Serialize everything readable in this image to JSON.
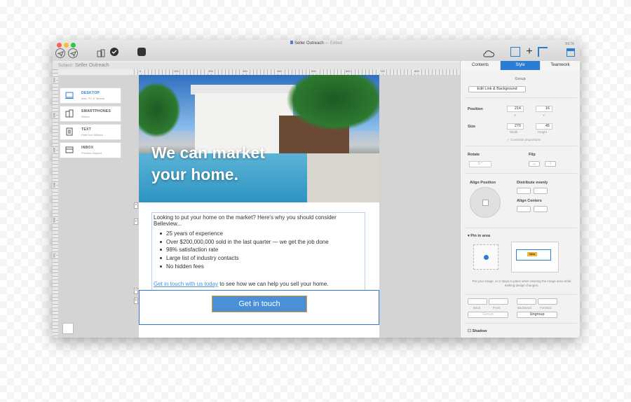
{
  "window": {
    "title": "Seller Outreach",
    "edited": "— Edited",
    "beta": "BETA"
  },
  "subject": {
    "label": "Subject",
    "value": "Seller Outreach"
  },
  "ruler_ticks": [
    "0",
    "100",
    "200",
    "300",
    "400",
    "500",
    "600",
    "700",
    "800"
  ],
  "vruler_ticks": [
    "200",
    "300",
    "400",
    "500",
    "600",
    "700"
  ],
  "devices": [
    {
      "title": "DESKTOP",
      "sub": "Mac, PC & Tablets",
      "selected": true
    },
    {
      "title": "SMARTPHONES",
      "sub": "Retina"
    },
    {
      "title": "TEXT",
      "sub": "Plain text fallback"
    },
    {
      "title": "INBOX",
      "sub": "Preview Snippet"
    }
  ],
  "email": {
    "headline_1": "We can market",
    "headline_2": "your home.",
    "intro": "Looking to put your home on the market? Here's why you should consider Belleview...",
    "bullets": [
      "25 years of experience",
      "Over $200,000,000 sold in the last quarter — we get the job done",
      "98% satisfaction rate",
      "Large list of industry contacts",
      "No hidden fees"
    ],
    "link_text": "Get in touch with us today",
    "outro_rest": " to see how we can help you sell your home.",
    "cta": "Get in touch"
  },
  "panel": {
    "tabs": [
      "Contents",
      "Style",
      "Teamwork"
    ],
    "active_tab": "Style",
    "group_label": "Group",
    "edit_link": "Edit Link & Background",
    "position_label": "Position",
    "x_value": "214",
    "x_label": "X",
    "y_value": "16",
    "y_label": "Y",
    "size_label": "Size",
    "width_value": "270",
    "width_label": "Width",
    "height_value": "45",
    "height_label": "Height",
    "constrain": "✓ Constrain proportions",
    "rotate_label": "Rotate",
    "rotate_value": "0 °",
    "flip_label": "Flip",
    "align_position": "Align Position",
    "distribute": "Distribute evenly",
    "align_centers": "Align Centers",
    "pin_label": "Pin in area",
    "pin_hint": "Pin your image, so it stays in place when resizing the image area while making design changes.",
    "pin_tag": "New",
    "back": "Back",
    "front": "Front",
    "backward": "Backward",
    "forward": "Forward",
    "group_btn": "Group",
    "ungroup_btn": "Ungroup",
    "shadow": "Shadow"
  },
  "colors": {
    "accent": "#2b7cd3",
    "cta": "#4a90d9"
  }
}
